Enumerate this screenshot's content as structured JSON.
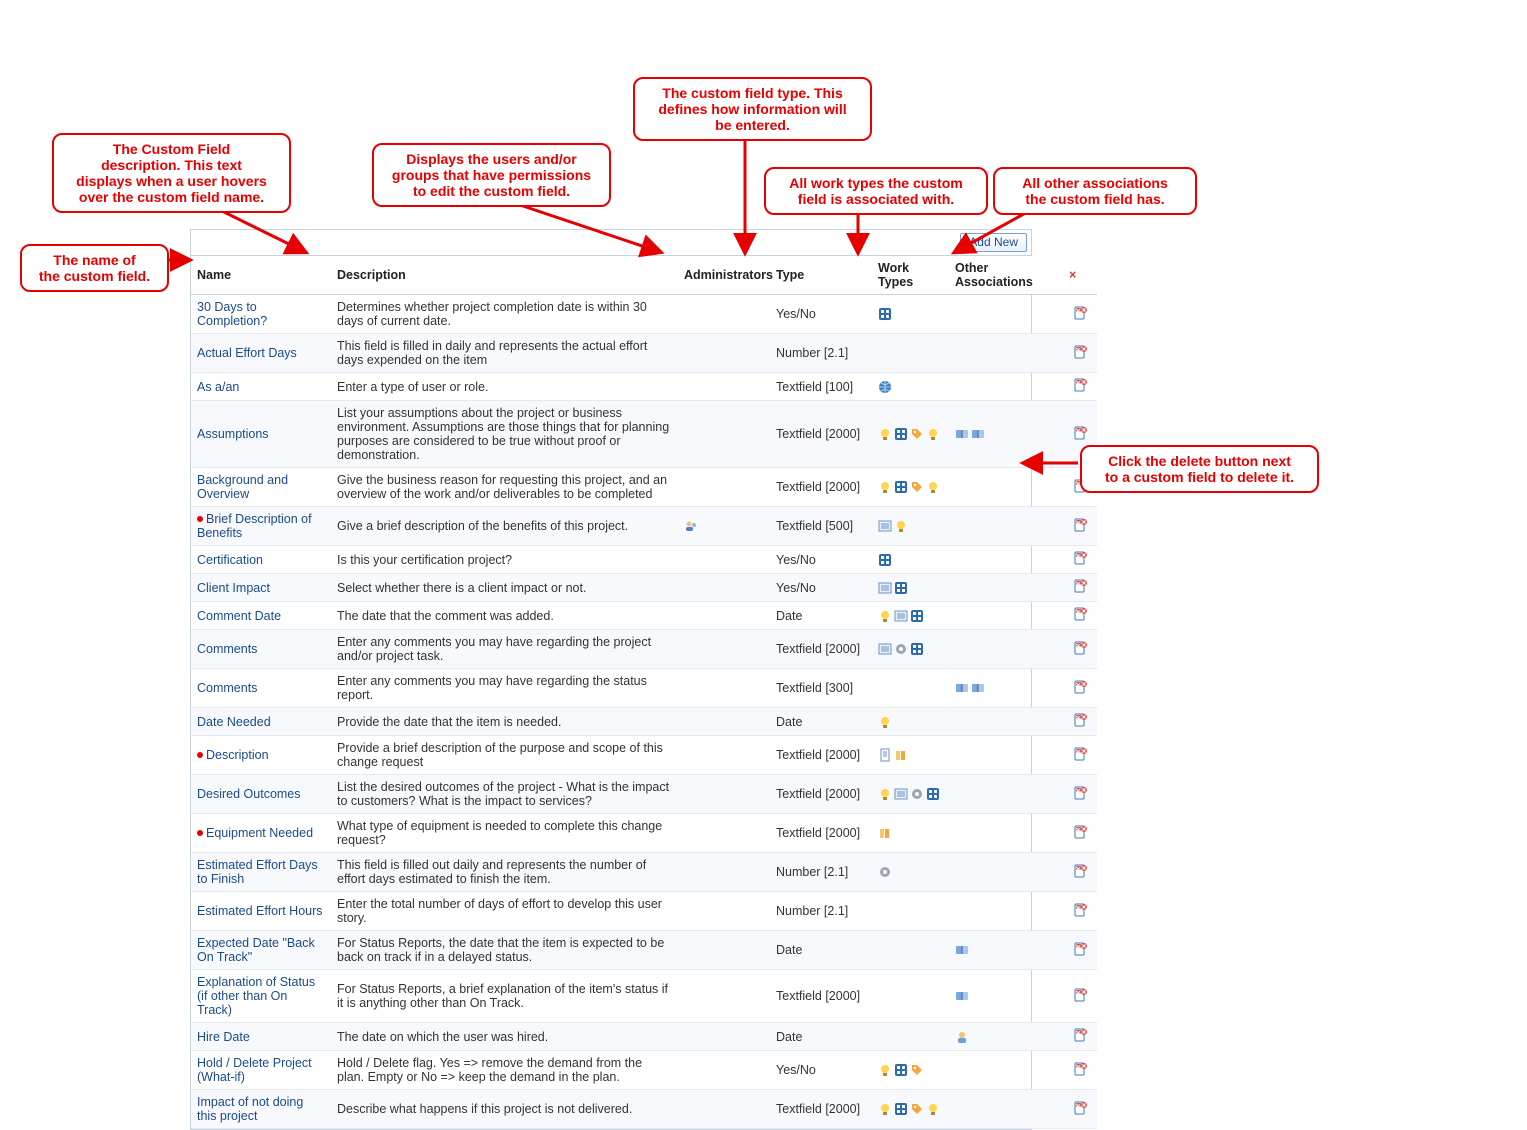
{
  "callouts": {
    "name": "The name of\nthe custom field.",
    "description": "The Custom Field\ndescription. This text\ndisplays when a user hovers\nover the custom field name.",
    "admins": "Displays the users and/or\ngroups that have permissions\nto edit the custom field.",
    "type": "The custom field type. This\ndefines how information will\nbe entered.",
    "work_types": "All work types the custom\nfield is associated with.",
    "other_assoc": "All other associations\nthe custom field has.",
    "delete": "Click the delete button next\nto a custom field to delete it."
  },
  "toolbar": {
    "add_new": "Add New"
  },
  "headers": {
    "name": "Name",
    "description": "Description",
    "admins": "Administrators",
    "type": "Type",
    "work_types": "Work Types",
    "other_assoc": "Other Associations",
    "del_icon": "×"
  },
  "rows": [
    {
      "name": "30 Days to Completion?",
      "req": false,
      "desc": "Determines whether project completion date is within 30 days of current date.",
      "admins": [],
      "type": "Yes/No",
      "wt": [
        "grid"
      ],
      "oa": []
    },
    {
      "name": "Actual Effort Days",
      "req": false,
      "desc": "This field is filled in daily and represents the actual effort days expended on the item",
      "admins": [],
      "type": "Number [2.1]",
      "wt": [],
      "oa": []
    },
    {
      "name": "As a/an",
      "req": false,
      "desc": "Enter a type of user or role.",
      "admins": [],
      "type": "Textfield [100]",
      "wt": [
        "globe"
      ],
      "oa": []
    },
    {
      "name": "Assumptions",
      "req": false,
      "desc": "List your assumptions about the project or business environment. Assumptions are those things that for planning purposes are considered to be true without proof or demonstration.",
      "admins": [],
      "type": "Textfield [2000]",
      "wt": [
        "bulb",
        "grid",
        "tag",
        "bulb"
      ],
      "oa": [
        "book",
        "book"
      ]
    },
    {
      "name": "Background and Overview",
      "req": false,
      "desc": "Give the business reason for requesting this project, and an overview of the work and/or deliverables to be completed",
      "admins": [],
      "type": "Textfield [2000]",
      "wt": [
        "bulb",
        "grid",
        "tag",
        "bulb"
      ],
      "oa": []
    },
    {
      "name": "Brief Description of Benefits",
      "req": true,
      "desc": "Give a brief description of the benefits of this project.",
      "admins": [
        "users"
      ],
      "type": "Textfield [500]",
      "wt": [
        "list",
        "bulb"
      ],
      "oa": []
    },
    {
      "name": "Certification",
      "req": false,
      "desc": "Is this your certification project?",
      "admins": [],
      "type": "Yes/No",
      "wt": [
        "grid"
      ],
      "oa": []
    },
    {
      "name": "Client Impact",
      "req": false,
      "desc": "Select whether there is a client impact or not.",
      "admins": [],
      "type": "Yes/No",
      "wt": [
        "list",
        "grid"
      ],
      "oa": []
    },
    {
      "name": "Comment Date",
      "req": false,
      "desc": "The date that the comment was added.",
      "admins": [],
      "type": "Date",
      "wt": [
        "bulb",
        "list",
        "grid"
      ],
      "oa": []
    },
    {
      "name": "Comments",
      "req": false,
      "desc": "Enter any comments you may have regarding the project and/or project task.",
      "admins": [],
      "type": "Textfield [2000]",
      "wt": [
        "list",
        "gear",
        "grid"
      ],
      "oa": []
    },
    {
      "name": "Comments",
      "req": false,
      "desc": "Enter any comments you may have regarding the status report.",
      "admins": [],
      "type": "Textfield [300]",
      "wt": [],
      "oa": [
        "book",
        "book"
      ]
    },
    {
      "name": "Date Needed",
      "req": false,
      "desc": "Provide the date that the item is needed.",
      "admins": [],
      "type": "Date",
      "wt": [
        "bulb"
      ],
      "oa": []
    },
    {
      "name": "Description",
      "req": true,
      "desc": "Provide a brief description of the purpose and scope of this change request",
      "admins": [],
      "type": "Textfield [2000]",
      "wt": [
        "doc",
        "stack"
      ],
      "oa": []
    },
    {
      "name": "Desired Outcomes",
      "req": false,
      "desc": "List the desired outcomes of the project - What is the impact to customers? What is the impact to services?",
      "admins": [],
      "type": "Textfield [2000]",
      "wt": [
        "bulb",
        "list",
        "gear",
        "grid"
      ],
      "oa": []
    },
    {
      "name": "Equipment Needed",
      "req": true,
      "desc": "What type of equipment is needed to complete this change request?",
      "admins": [],
      "type": "Textfield [2000]",
      "wt": [
        "stack"
      ],
      "oa": []
    },
    {
      "name": "Estimated Effort Days to Finish",
      "req": false,
      "desc": "This field is filled out daily and represents the number of effort days estimated to finish the item.",
      "admins": [],
      "type": "Number [2.1]",
      "wt": [
        "gear"
      ],
      "oa": []
    },
    {
      "name": "Estimated Effort Hours",
      "req": false,
      "desc": "Enter the total number of days of effort to develop this user story.",
      "admins": [],
      "type": "Number [2.1]",
      "wt": [],
      "oa": []
    },
    {
      "name": "Expected Date \"Back On Track\"",
      "req": false,
      "desc": "For Status Reports, the date that the item is expected to be back on track if in a delayed status.",
      "admins": [],
      "type": "Date",
      "wt": [],
      "oa": [
        "book"
      ]
    },
    {
      "name": "Explanation of Status (if other than On Track)",
      "req": false,
      "desc": "For Status Reports, a brief explanation of the item's status if it is anything other than On Track.",
      "admins": [],
      "type": "Textfield [2000]",
      "wt": [],
      "oa": [
        "book"
      ]
    },
    {
      "name": "Hire Date",
      "req": false,
      "desc": "The date on which the user was hired.",
      "admins": [],
      "type": "Date",
      "wt": [],
      "oa": [
        "user"
      ]
    },
    {
      "name": "Hold / Delete Project (What-if)",
      "req": false,
      "desc": "Hold / Delete flag. Yes => remove the demand from the plan. Empty or No => keep the demand in the plan.",
      "admins": [],
      "type": "Yes/No",
      "wt": [
        "bulb",
        "grid",
        "tag"
      ],
      "oa": []
    },
    {
      "name": "Impact of not doing this project",
      "req": false,
      "desc": "Describe what happens if this project is not delivered.",
      "admins": [],
      "type": "Textfield [2000]",
      "wt": [
        "bulb",
        "grid",
        "tag",
        "bulb"
      ],
      "oa": []
    }
  ]
}
